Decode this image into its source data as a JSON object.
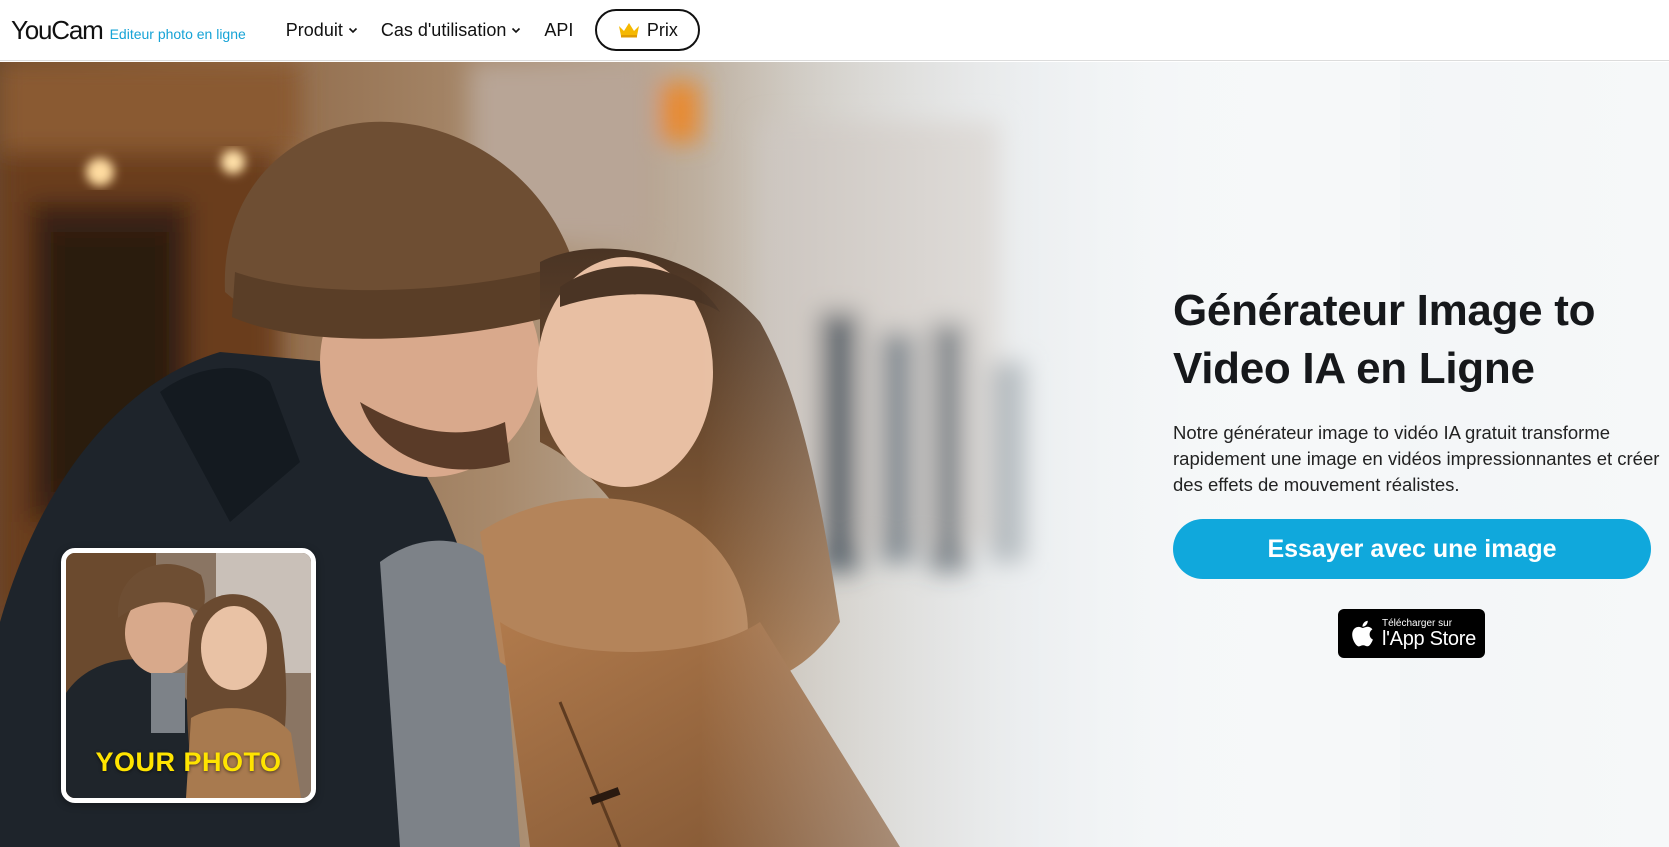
{
  "header": {
    "logo_word": "YouCam",
    "logo_tag": "Editeur photo en ligne",
    "nav": [
      {
        "label": "Produit",
        "has_dropdown": true
      },
      {
        "label": "Cas d'utilisation",
        "has_dropdown": true
      },
      {
        "label": "API",
        "has_dropdown": false
      }
    ],
    "price_button": {
      "label": "Prix",
      "icon": "crown-icon"
    }
  },
  "hero": {
    "title": "Générateur Image to Video IA en Ligne",
    "description": "Notre générateur image to vidéo IA gratuit transforme rapidement une image en vidéos impressionnantes et créer des effets de mouvement réalistes.",
    "cta_label": "Essayer avec une image",
    "thumbnail_label": "YOUR PHOTO",
    "app_store": {
      "small": "Télécharger sur",
      "big": "l'App Store",
      "icon": "apple-icon"
    }
  },
  "colors": {
    "accent": "#10a8dc",
    "logo_tag": "#16a3d6",
    "thumbnail_label": "#ffe400",
    "crown": "#f5b800"
  }
}
